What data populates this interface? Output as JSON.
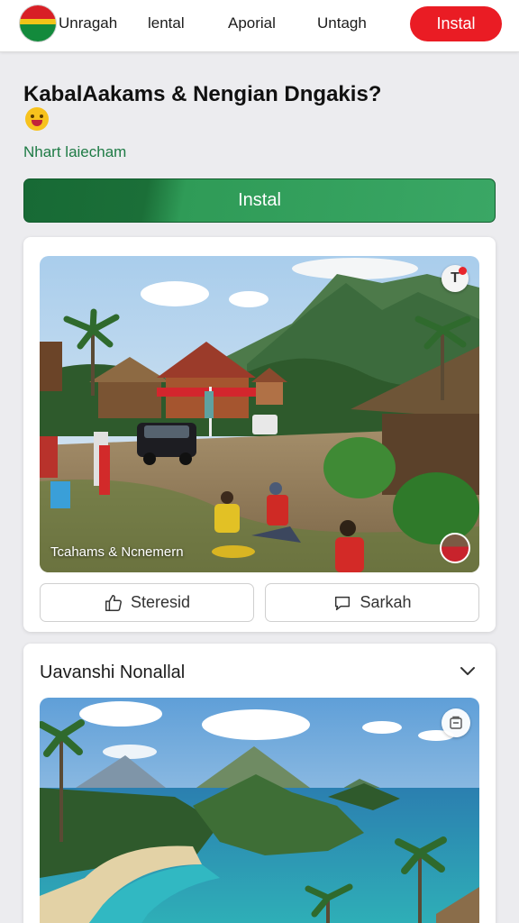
{
  "nav": {
    "items": [
      "Unragah",
      "lental",
      "Aporial",
      "Untagh"
    ],
    "install_label": "Instal"
  },
  "hero": {
    "title": "KabalAakams & Nengian Dngakis?",
    "subtitle": "Nhart laiecham",
    "install_label": "Instal"
  },
  "post": {
    "image_caption": "Tcahams & Ncnemern",
    "badge_letter": "T",
    "like_label": "Steresid",
    "share_label": "Sarkah"
  },
  "section": {
    "title": "Uavanshi Nonallal"
  },
  "colors": {
    "brand_red": "#ea1c24",
    "brand_green": "#1b6f38",
    "subtitle_green": "#1e7b45"
  },
  "icons": [
    "flag-logo-icon",
    "thumbs-up-icon",
    "comment-icon",
    "chevron-down-icon",
    "notification-icon",
    "save-icon"
  ]
}
